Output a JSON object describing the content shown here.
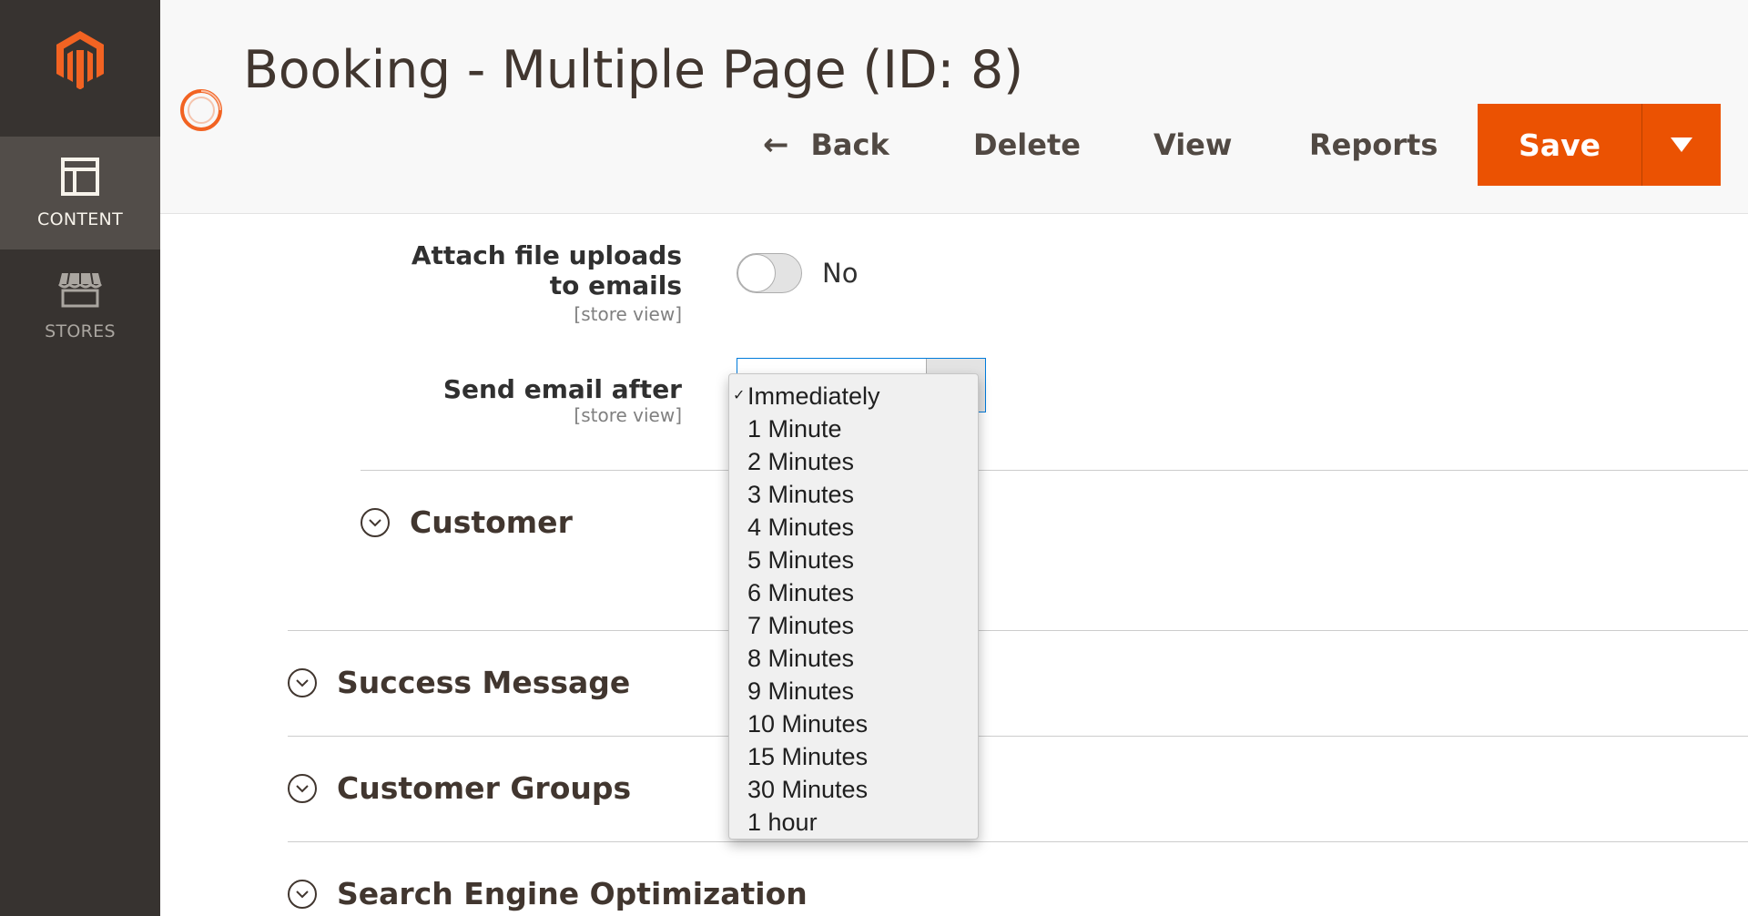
{
  "sidebar": {
    "items": [
      {
        "label": "CONTENT",
        "icon": "content-icon",
        "active": true
      },
      {
        "label": "STORES",
        "icon": "stores-icon",
        "active": false
      }
    ]
  },
  "header": {
    "title": "Booking - Multiple Page (ID: 8)",
    "actions": {
      "back": "Back",
      "delete": "Delete",
      "view": "View",
      "reports": "Reports",
      "save": "Save"
    }
  },
  "form": {
    "attach_uploads": {
      "label": "Attach file uploads to emails",
      "scope": "[store view]",
      "value": "No",
      "enabled": false
    },
    "send_email_after": {
      "label": "Send email after",
      "scope": "[store view]",
      "selected": "Immediately",
      "options": [
        "Immediately",
        "1 Minute",
        "2 Minutes",
        "3 Minutes",
        "4 Minutes",
        "5 Minutes",
        "6 Minutes",
        "7 Minutes",
        "8 Minutes",
        "9 Minutes",
        "10 Minutes",
        "15 Minutes",
        "30 Minutes",
        "1 hour"
      ]
    }
  },
  "sections": {
    "customer": "Customer",
    "success_message": "Success Message",
    "customer_groups": "Customer Groups",
    "seo": "Search Engine Optimization"
  },
  "colors": {
    "brand_orange": "#eb5202",
    "sidebar_bg": "#373330",
    "sidebar_active": "#524d49",
    "focus_blue": "#007bdb"
  }
}
